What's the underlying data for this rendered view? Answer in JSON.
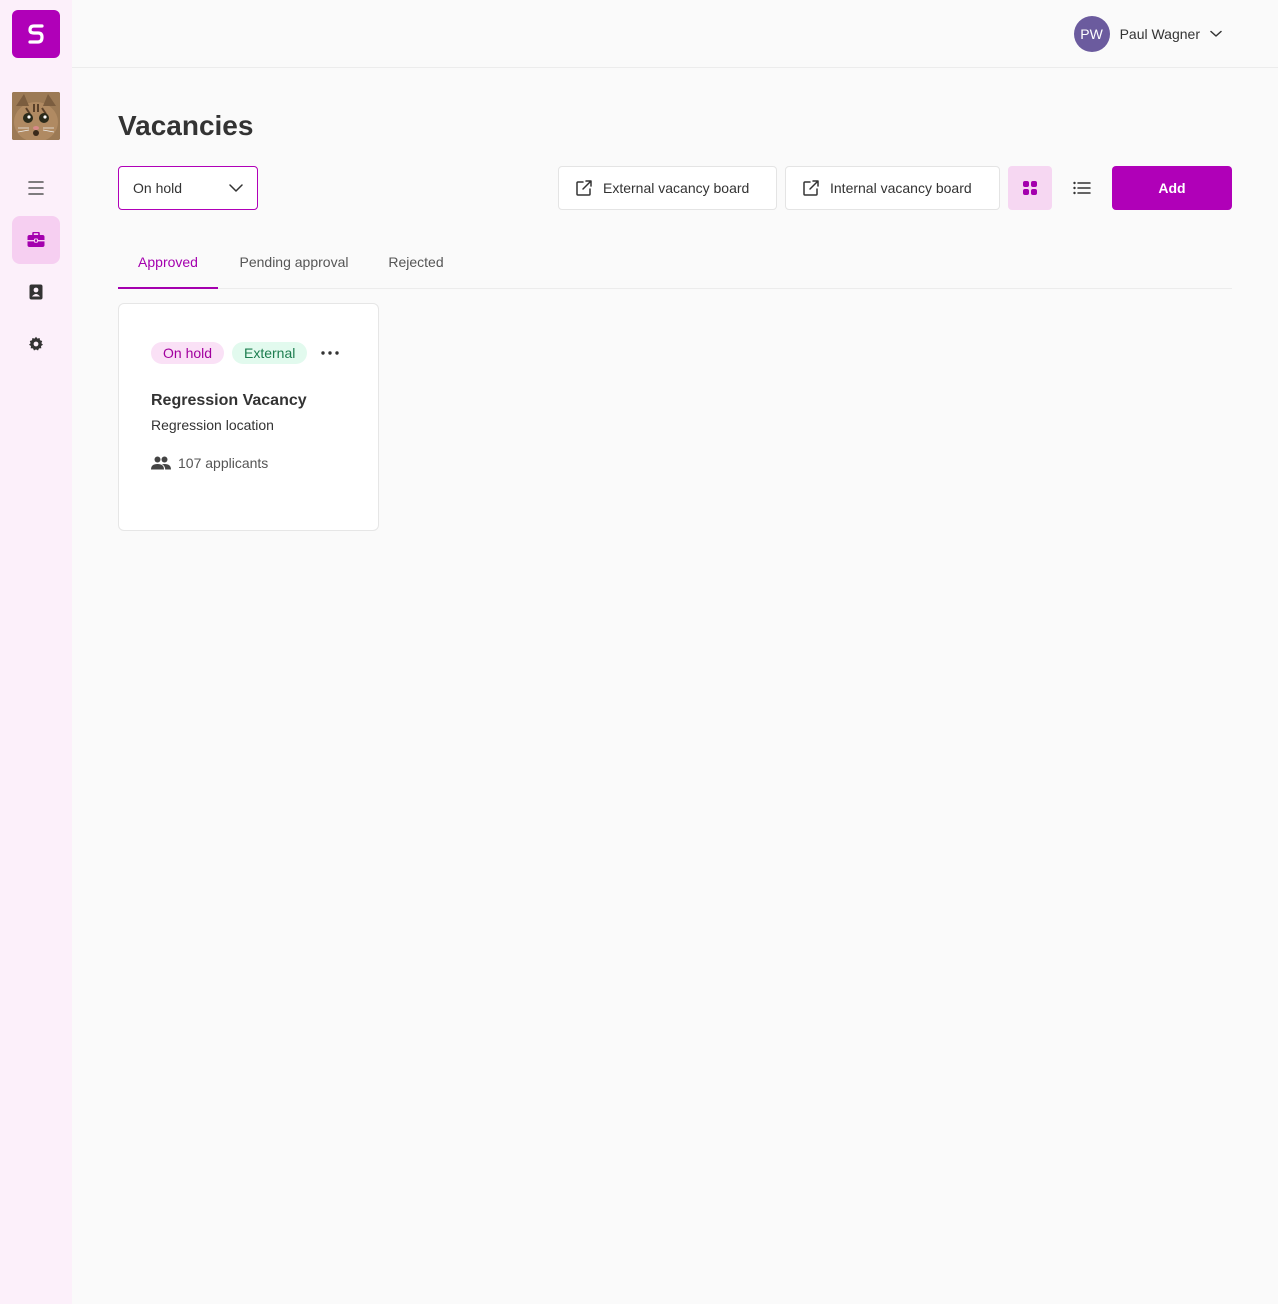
{
  "user": {
    "initials": "PW",
    "name": "Paul Wagner"
  },
  "page": {
    "title": "Vacancies"
  },
  "status_filter": {
    "selected": "On hold"
  },
  "toolbar": {
    "external_board_label": "External vacancy board",
    "internal_board_label": "Internal vacancy board",
    "add_label": "Add"
  },
  "tabs": [
    {
      "label": "Approved",
      "active": true
    },
    {
      "label": "Pending approval",
      "active": false
    },
    {
      "label": "Rejected",
      "active": false
    }
  ],
  "vacancies": [
    {
      "status_badge": "On hold",
      "type_badge": "External",
      "title": "Regression Vacancy",
      "location": "Regression location",
      "applicants": "107 applicants"
    }
  ],
  "icons": {
    "sidebar": [
      "menu-icon",
      "briefcase-icon",
      "contact-book-icon",
      "gear-icon"
    ],
    "card": [
      "more-horizontal-icon",
      "people-icon"
    ]
  },
  "colors": {
    "brand": "#b000b8",
    "sidebar_bg": "#fcf0fa",
    "active_item_bg": "#f6cff1",
    "avatar": "#6b5b9e",
    "on_hold_badge_bg": "#fae1f6",
    "external_badge_bg": "#e2faee"
  }
}
